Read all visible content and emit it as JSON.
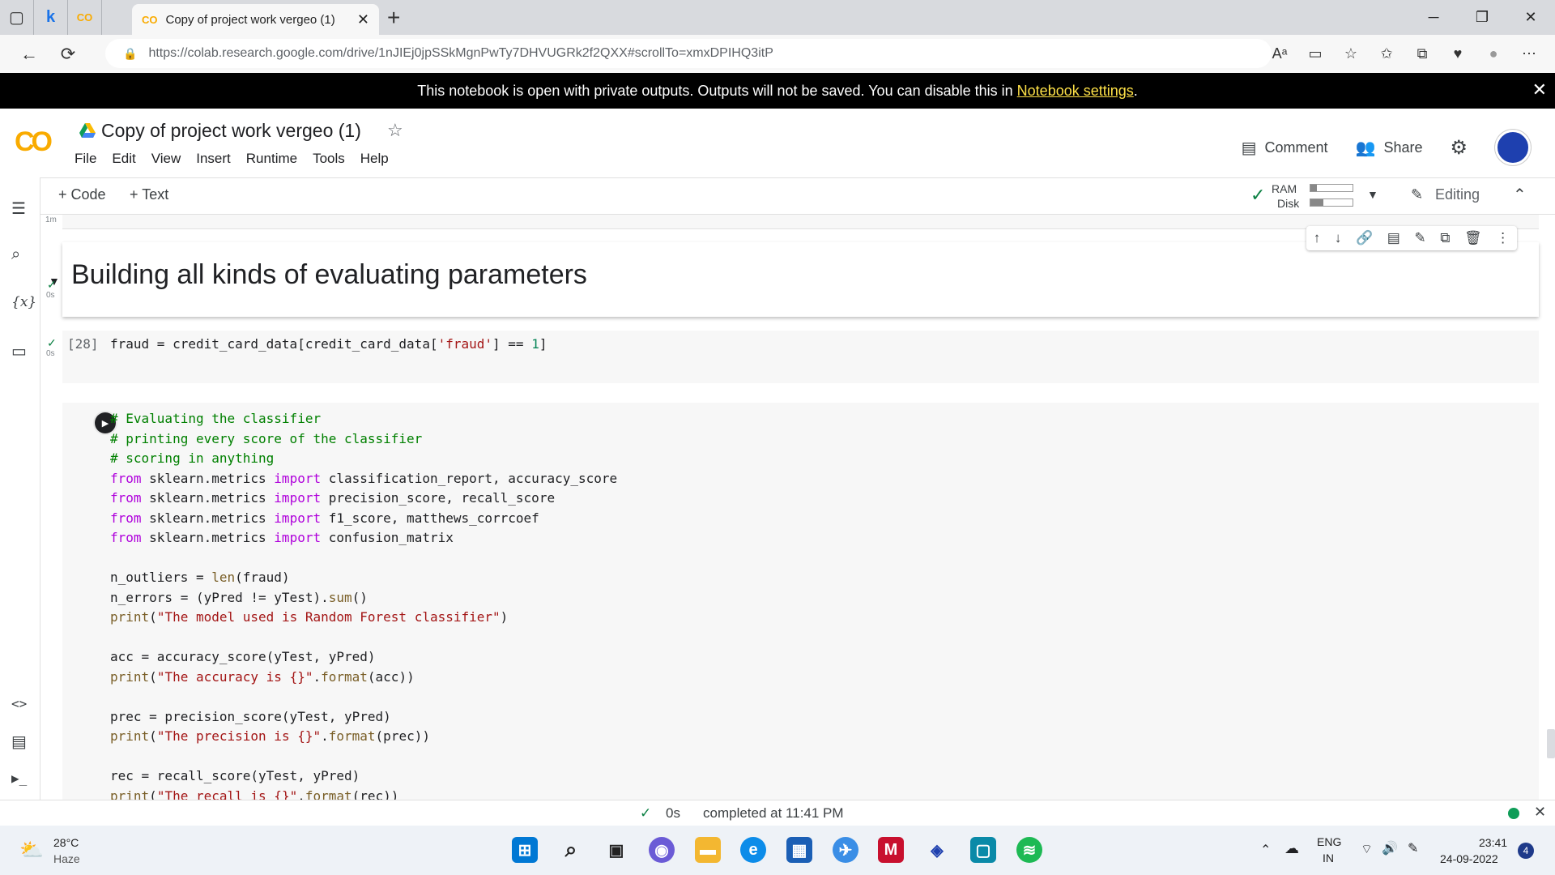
{
  "browser": {
    "tab_title": "Copy of project work vergeo (1)",
    "url": "https://colab.research.google.com/drive/1nJIEj0jpSSkMgnPwTy7DHVUGRk2f2QXX#scrollTo=xmxDPIHQ3itP",
    "pinned_tab_k": "k",
    "pinned_tab_co": "CO"
  },
  "banner": {
    "text": "This notebook is open with private outputs. Outputs will not be saved. You can disable this in",
    "link": "Notebook settings",
    "end": "."
  },
  "header": {
    "logo": "CO",
    "title": "Copy of project work vergeo (1)",
    "menu": [
      "File",
      "Edit",
      "View",
      "Insert",
      "Runtime",
      "Tools",
      "Help"
    ],
    "comment_label": "Comment",
    "share_label": "Share"
  },
  "toolbar": {
    "code_label": "+ Code",
    "text_label": "+ Text",
    "ram_label": "RAM",
    "disk_label": "Disk",
    "ram_fraction": 0.15,
    "disk_fraction": 0.3,
    "editing_label": "Editing"
  },
  "cells": {
    "prev_time": "1m",
    "heading": "Building all kinds of evaluating parameters",
    "cell28": {
      "exec": "[28]",
      "time": "0s",
      "code": "fraud = credit_card_data[credit_card_data['fraud'] == 1]"
    },
    "cell29": {
      "time": "0s",
      "lines": [
        "# Evaluating the classifier",
        "# printing every score of the classifier",
        "# scoring in anything",
        "from sklearn.metrics import classification_report, accuracy_score",
        "from sklearn.metrics import precision_score, recall_score",
        "from sklearn.metrics import f1_score, matthews_corrcoef",
        "from sklearn.metrics import confusion_matrix",
        "",
        "n_outliers = len(fraud)",
        "n_errors = (yPred != yTest).sum()",
        "print(\"The model used is Random Forest classifier\")",
        "",
        "acc = accuracy_score(yTest, yPred)",
        "print(\"The accuracy is {}\".format(acc))",
        "",
        "prec = precision_score(yTest, yPred)",
        "print(\"The precision is {}\".format(prec))",
        "",
        "rec = recall_score(yTest, yPred)",
        "print(\"The recall is {}\".format(rec))"
      ]
    }
  },
  "status": {
    "time": "0s",
    "text": "completed at 11:41 PM"
  },
  "taskbar": {
    "temp": "28°C",
    "weather": "Haze",
    "lang1": "ENG",
    "lang2": "IN",
    "clock_time": "23:41",
    "clock_date": "24-09-2022",
    "notif_count": "4"
  }
}
